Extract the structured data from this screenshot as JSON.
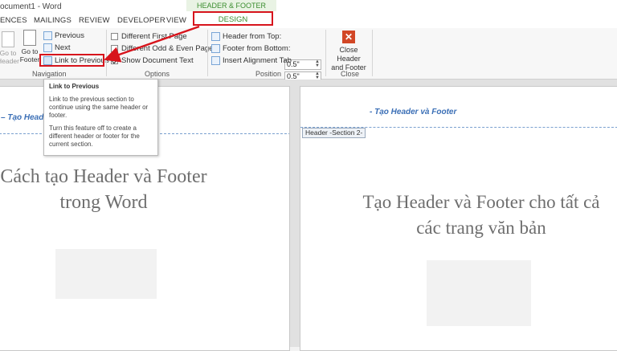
{
  "window": {
    "title": "ocument1 - Word"
  },
  "context_tab": {
    "label": "HEADER & FOOTER TOOLS"
  },
  "tabs": [
    {
      "label": "ENCES"
    },
    {
      "label": "MAILINGS"
    },
    {
      "label": "REVIEW"
    },
    {
      "label": "DEVELOPER"
    },
    {
      "label": "VIEW"
    },
    {
      "label": "DESIGN"
    }
  ],
  "ribbon": {
    "navigation": {
      "go_to_header": "Go to\nHeader",
      "go_to_footer": "Go to\nFooter",
      "previous": "Previous",
      "next": "Next",
      "link_to_previous": "Link to Previous",
      "label": "Navigation"
    },
    "options": {
      "different_first_page": "Different First Page",
      "different_odd_even": "Different Odd & Even Pages",
      "show_document_text": "Show Document Text",
      "label": "Options"
    },
    "position": {
      "header_from_top": "Header from Top:",
      "header_from_top_value": "0.5\"",
      "footer_from_bottom": "Footer from Bottom:",
      "footer_from_bottom_value": "0.5\"",
      "insert_alignment_tab": "Insert Alignment Tab",
      "label": "Position"
    },
    "close": {
      "button": "Close Header\nand Footer",
      "label": "Close"
    }
  },
  "tooltip": {
    "title": "Link to Previous",
    "para1": "Link to the previous section to continue using the same header or footer.",
    "para2": "Turn this feature off to create a different header or footer for the current section."
  },
  "pages": {
    "left": {
      "header": "– Tạo Heade",
      "body_line1": "Cách tạo Header và Footer",
      "body_line2": "trong Word"
    },
    "right": {
      "header": "- Tạo Header và Footer",
      "section_tag": "Header -Section 2-",
      "body_line1": "Tạo Header và Footer cho tất cả",
      "body_line2": "các trang văn bản"
    }
  },
  "colors": {
    "highlight": "#d7141c",
    "context_green": "#3a8d2e",
    "header_blue": "#3b6fb6"
  }
}
